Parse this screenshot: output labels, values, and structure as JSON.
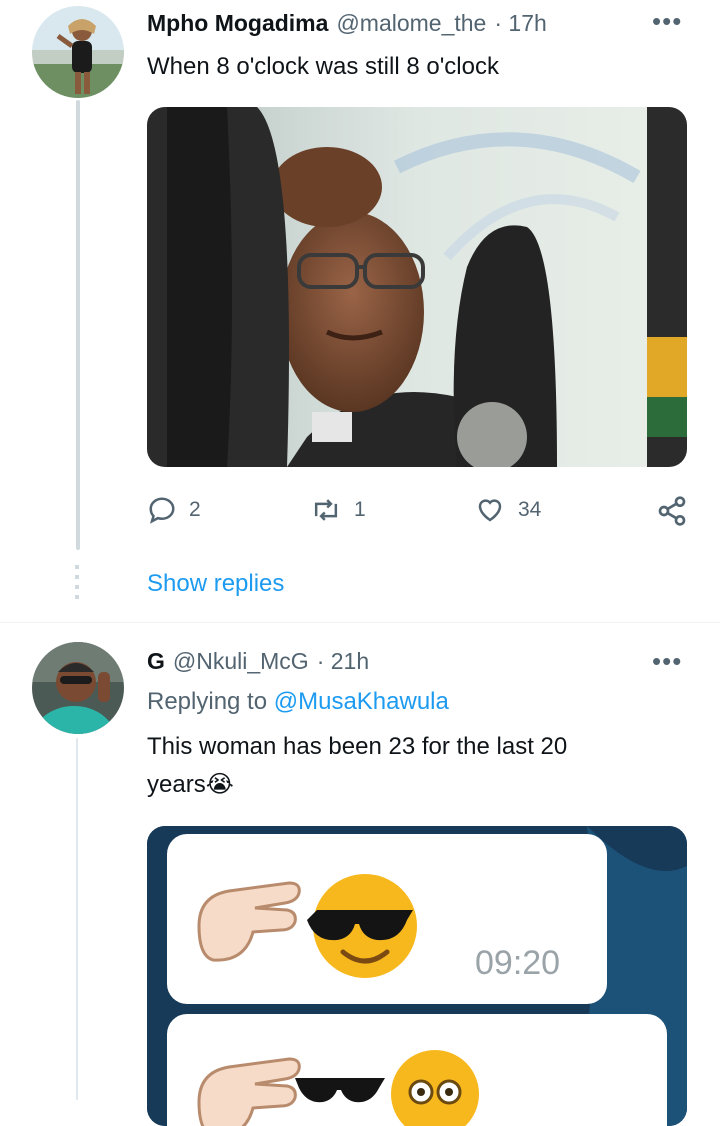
{
  "tweet1": {
    "name": "Mpho Mogadima",
    "handle": "@malome_the",
    "time": "· 17h",
    "text": "When 8 o'clock was still 8 o'clock",
    "replies": "2",
    "retweets": "1",
    "likes": "34",
    "more_icon": "more-dots-icon"
  },
  "show_replies": "Show replies",
  "tweet2": {
    "name": "G",
    "handle": "@Nkuli_McG",
    "time": "· 21h",
    "replying_prefix": "Replying to",
    "replying_handle": "@MusaKhawula",
    "text_line1": "This woman has been 23 for the last 20",
    "text_line2": "years😭",
    "bubble_time": "09:20"
  },
  "colors": {
    "accent": "#1d9bf0",
    "muted": "#536471",
    "thread_line": "#cfd9de"
  }
}
